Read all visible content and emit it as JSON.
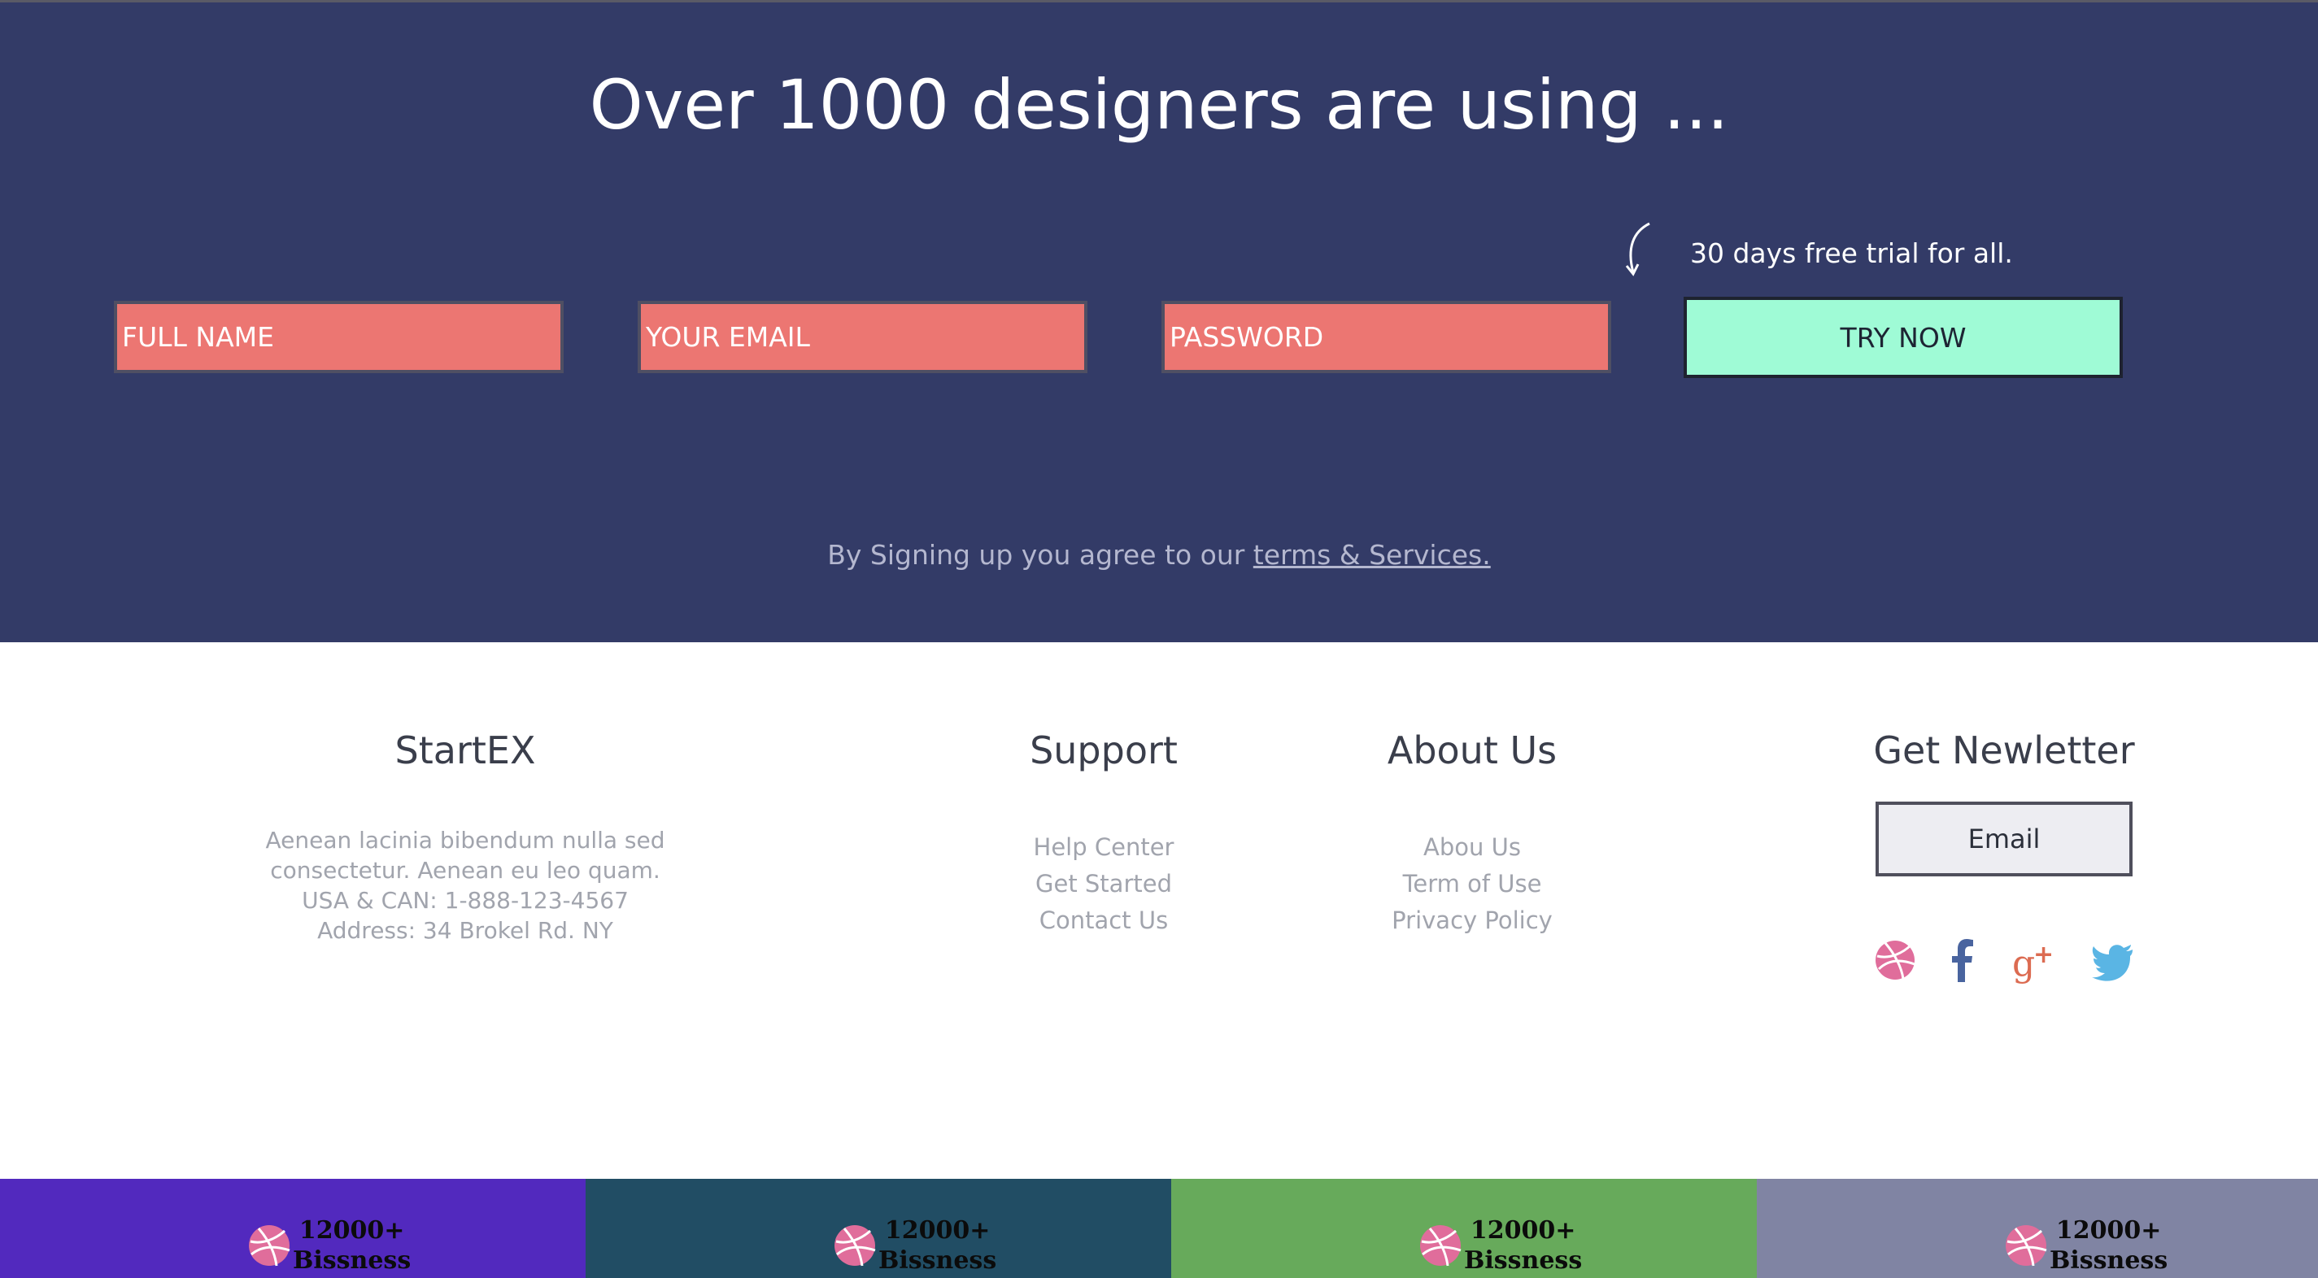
{
  "signup": {
    "headline": "Over 1000 designers are using ...",
    "trial_note": "30 days free trial for all.",
    "full_name_placeholder": "FULL NAME",
    "email_placeholder": "YOUR EMAIL",
    "password_placeholder": "PASSWORD",
    "try_label": "TRY NOW",
    "agree_prefix": "By Signing up you agree to our ",
    "agree_link": "terms & Services."
  },
  "footer": {
    "brand": {
      "title": "StartEX",
      "lines": [
        "Aenean lacinia bibendum nulla sed",
        "consectetur. Aenean eu leo quam.",
        "USA & CAN: 1-888-123-4567",
        "Address: 34 Brokel Rd. NY"
      ]
    },
    "support": {
      "title": "Support",
      "links": [
        "Help Center",
        "Get Started",
        "Contact Us"
      ]
    },
    "about": {
      "title": "About Us",
      "links": [
        "Abou Us",
        "Term of Use",
        "Privacy Policy"
      ]
    },
    "newsletter": {
      "title": "Get Newletter",
      "email_placeholder": "Email"
    },
    "social_icons": [
      "dribbble-icon",
      "facebook-icon",
      "google-plus-icon",
      "twitter-icon"
    ]
  },
  "stats": [
    {
      "value": "12000+",
      "label": "Bissness",
      "color": "#5229be"
    },
    {
      "value": "12000+",
      "label": "Bissness",
      "color": "#214d64"
    },
    {
      "value": "12000+",
      "label": "Bissness",
      "color": "#67aa5b"
    },
    {
      "value": "12000+",
      "label": "Bissness",
      "color": "#8084a3"
    }
  ],
  "colors": {
    "signup_bg": "#333b67",
    "field_bg": "#ec7672",
    "try_bg": "#9ffbd6",
    "dribbble_pink": "#e06d9b",
    "facebook_blue": "#49649f",
    "gplus_red": "#dc6b51",
    "twitter_blue": "#5ab5e4"
  }
}
